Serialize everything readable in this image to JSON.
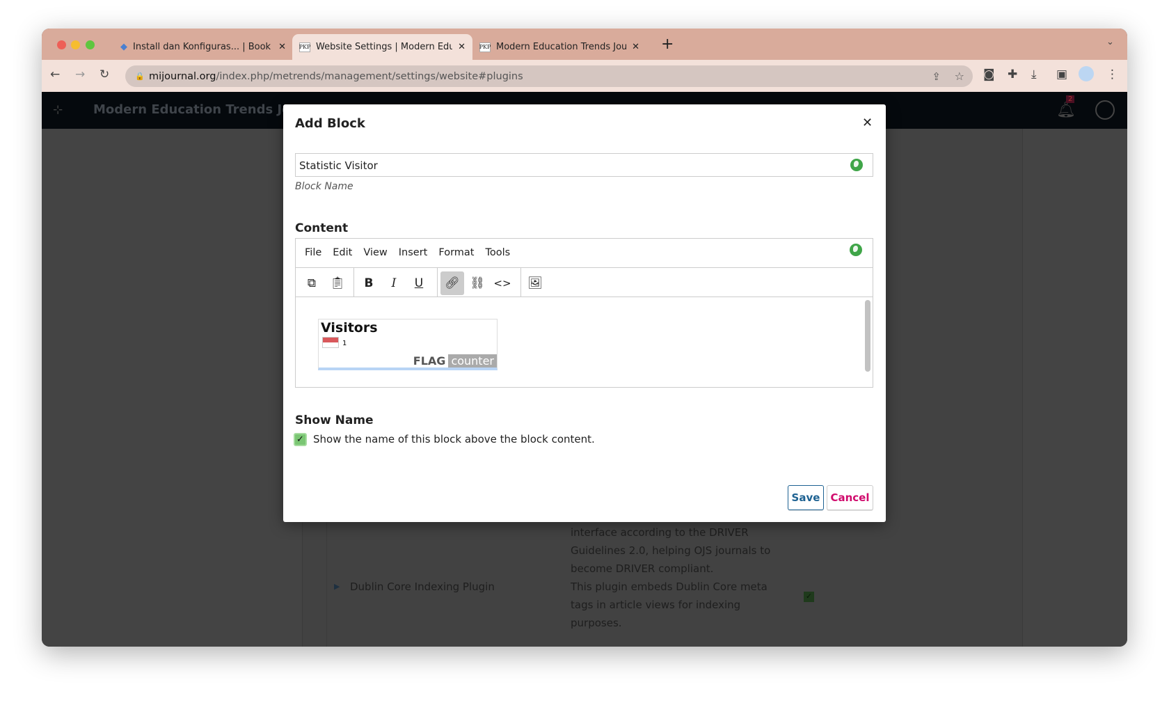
{
  "browser": {
    "tabs": [
      {
        "title": "Install dan Konfiguras... | Book",
        "icon": "book-icon",
        "active": false
      },
      {
        "title": "Website Settings | Modern Edu",
        "icon": "pkp-icon",
        "active": true
      },
      {
        "title": "Modern Education Trends Jou",
        "icon": "pkp-icon",
        "active": false
      }
    ],
    "favicon_text": "PKP",
    "url_host": "mijournal.org",
    "url_path": "/index.php/metrends/management/settings/website#plugins"
  },
  "app": {
    "journal_title": "Modern Education Trends Journ",
    "notification_count": "2"
  },
  "background": {
    "desc_lines": [
      "interface according to the DRIVER",
      "Guidelines 2.0, helping OJS journals to",
      "become DRIVER compliant."
    ],
    "plugin_name": "Dublin Core Indexing Plugin",
    "plugin_desc": [
      "This plugin embeds Dublin Core meta",
      "tags in article views for indexing",
      "purposes."
    ],
    "plugin_enabled": true
  },
  "dialog": {
    "title": "Add Block",
    "block_name_value": "Statistic Visitor",
    "block_name_label": "Block Name",
    "content_label": "Content",
    "menu": [
      "File",
      "Edit",
      "View",
      "Insert",
      "Format",
      "Tools"
    ],
    "widget": {
      "title": "Visitors",
      "count": "1",
      "brand_a": "FLAG",
      "brand_b": "counter"
    },
    "show_name_label": "Show Name",
    "show_name_checkbox": "Show the name of this block above the block content.",
    "show_name_checked": true,
    "save": "Save",
    "cancel": "Cancel"
  },
  "colors": {
    "save": "#1e6292",
    "cancel": "#d00a6c",
    "globe": "#3fa548",
    "checkbox": "#7ac673"
  }
}
